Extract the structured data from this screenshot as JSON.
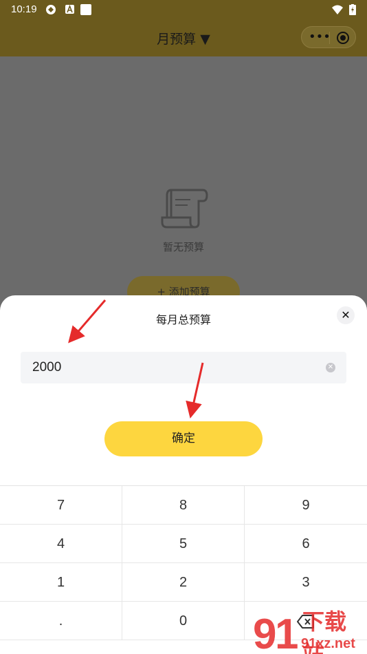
{
  "status_bar": {
    "time": "10:19"
  },
  "header": {
    "title": "月预算 ▼"
  },
  "background": {
    "empty_text": "暂无预算",
    "add_button": "+ 添加预算"
  },
  "sheet": {
    "title": "每月总预算",
    "close_label": "✕",
    "amount_value": "2000",
    "confirm_label": "确定"
  },
  "keypad": {
    "keys": [
      "7",
      "8",
      "9",
      "4",
      "5",
      "6",
      "1",
      "2",
      "3",
      ".",
      "0"
    ]
  },
  "watermark": {
    "text": "下载站",
    "site": "91xz.net"
  },
  "colors": {
    "accent_yellow": "#fdd63f",
    "annotation_red": "#e52b2b"
  }
}
